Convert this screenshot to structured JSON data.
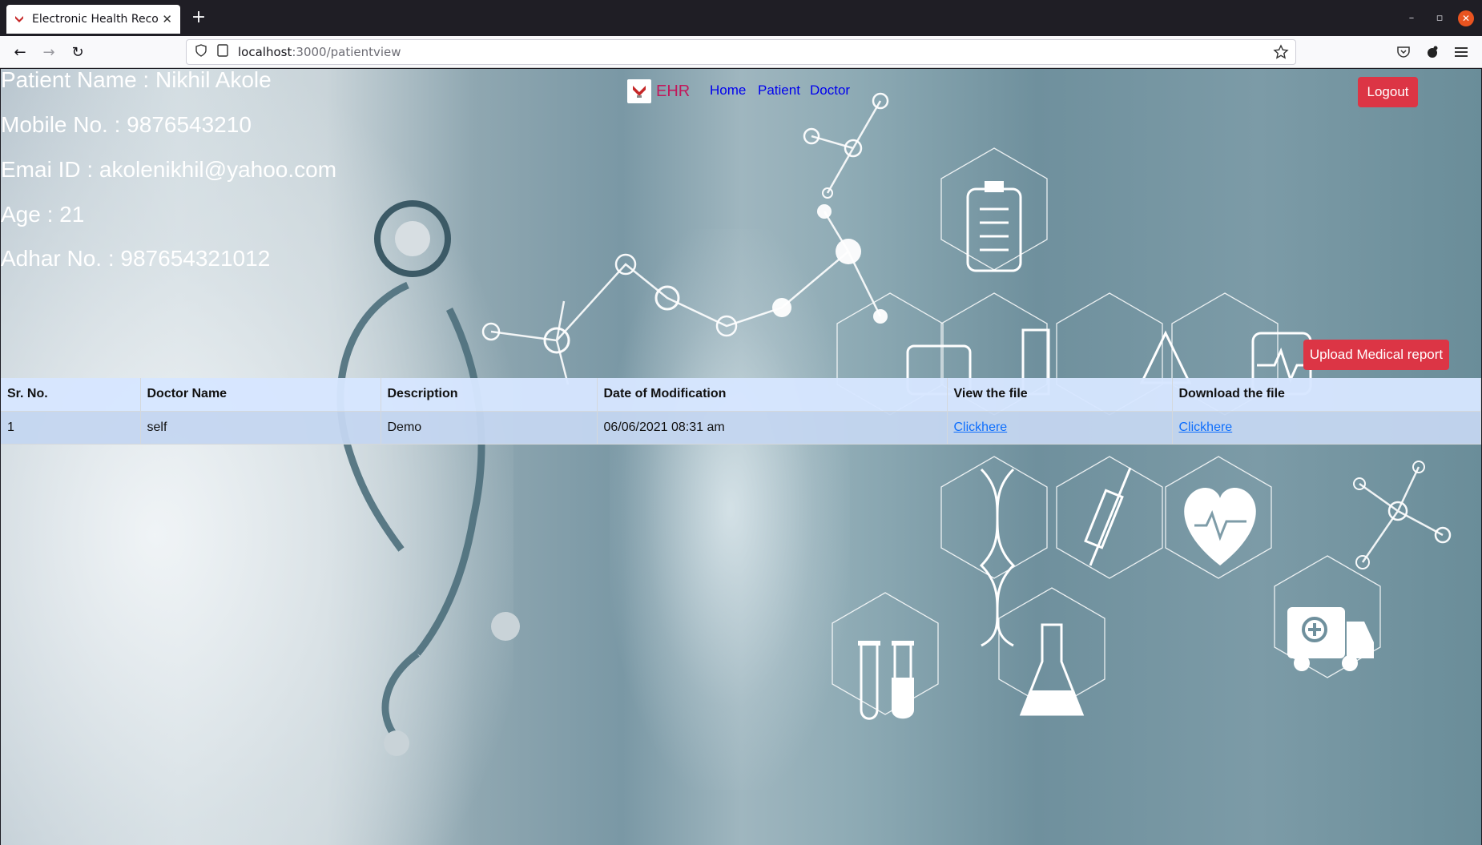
{
  "browser": {
    "tab_title": "Electronic Health Records",
    "url_host": "localhost",
    "url_path": ":3000/patientview"
  },
  "patient": {
    "name_line": "Patient Name : Nikhil Akole",
    "mobile_line": "Mobile No. : 9876543210",
    "email_line": "Emai ID : akolenikhil@yahoo.com",
    "age_line": "Age : 21",
    "adhar_line": "Adhar No. : 987654321012"
  },
  "nav": {
    "brand": "EHR",
    "links": [
      "Home",
      "Patient",
      "Doctor"
    ],
    "logout": "Logout"
  },
  "upload_button": "Upload Medical report",
  "table": {
    "headers": [
      "Sr. No.",
      "Doctor Name",
      "Description",
      "Date of Modification",
      "View the file",
      "Download the file"
    ],
    "rows": [
      [
        "1",
        "self",
        "Demo",
        "06/06/2021 08:31 am",
        "Clickhere",
        "Clickhere"
      ]
    ]
  },
  "colors": {
    "danger": "#dc3545",
    "brand": "#c2185b",
    "link": "#0000ee"
  }
}
